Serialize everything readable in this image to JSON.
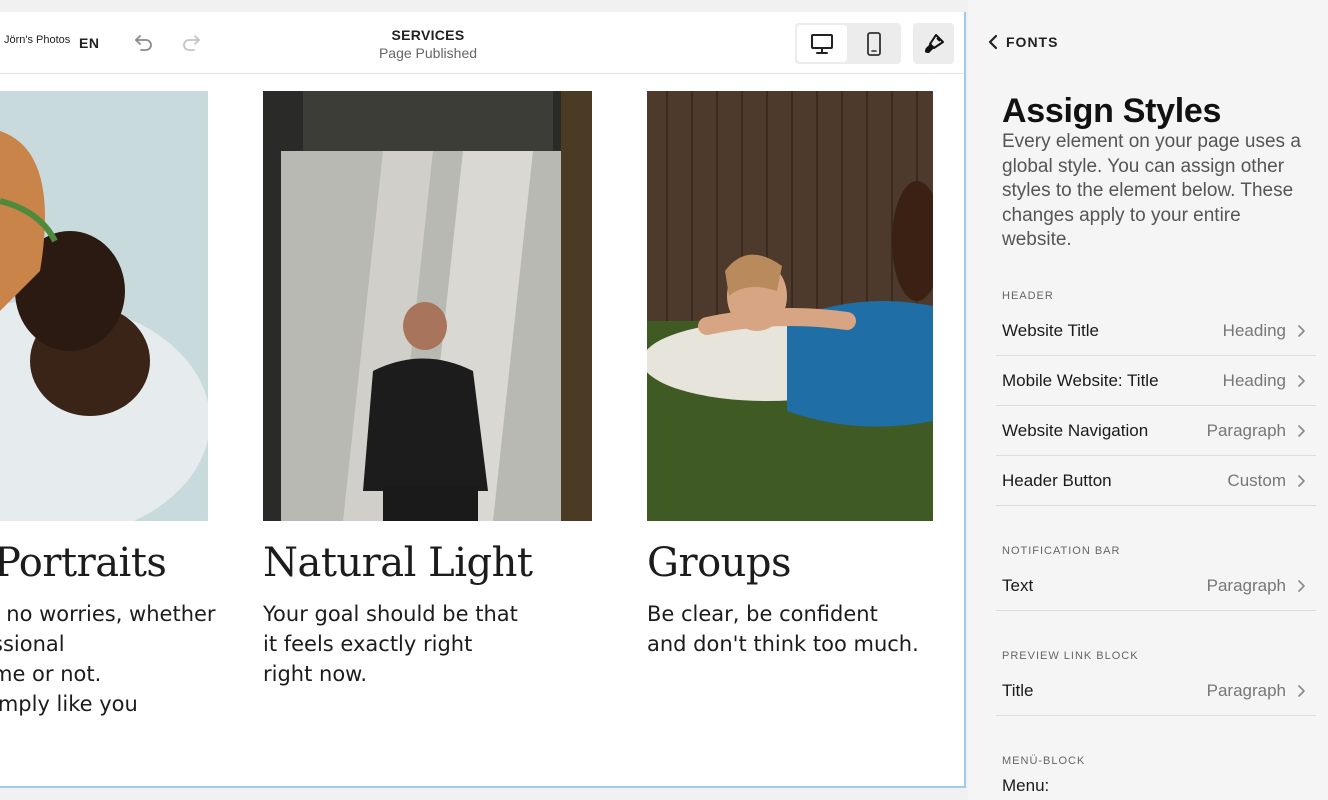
{
  "topbar": {
    "site_name": "Jörn's Photos",
    "language": "EN",
    "page_title": "SERVICES",
    "page_status": "Page Published"
  },
  "icons": {
    "undo": "undo-icon",
    "redo": "redo-icon",
    "desktop": "desktop-icon",
    "mobile": "mobile-icon",
    "design": "paintbrush-icon",
    "back": "chevron-left-icon",
    "row": "chevron-right-icon"
  },
  "colors": {
    "canvas_border": "#9ecbe6",
    "panel_bg": "#f5f5f5"
  },
  "gallery": [
    {
      "title": "Portraits",
      "lines": [
        "- no worries, whether",
        "ssional",
        "me or not.",
        "imply like you"
      ]
    },
    {
      "title": "Natural Light",
      "lines": [
        "Your goal should be that",
        "it feels exactly right",
        "right now."
      ]
    },
    {
      "title": "Groups",
      "lines": [
        "Be clear, be confident",
        "and don't think too much."
      ]
    }
  ],
  "panel": {
    "back_label": "FONTS",
    "title": "Assign Styles",
    "description": "Every element on your page uses a global style. You can assign other styles to the element below. These changes apply to your entire website.",
    "sections": [
      {
        "label": "HEADER",
        "rows": [
          {
            "label": "Website Title",
            "value": "Heading"
          },
          {
            "label": "Mobile Website: Title",
            "value": "Heading"
          },
          {
            "label": "Website Navigation",
            "value": "Paragraph"
          },
          {
            "label": "Header Button",
            "value": "Custom"
          }
        ]
      },
      {
        "label": "NOTIFICATION BAR",
        "rows": [
          {
            "label": "Text",
            "value": "Paragraph"
          }
        ]
      },
      {
        "label": "PREVIEW LINK BLOCK",
        "rows": [
          {
            "label": "Title",
            "value": "Paragraph"
          }
        ]
      },
      {
        "label": "MENÜ-BLOCK",
        "rows": [
          {
            "label": "Menu:",
            "value": ""
          }
        ]
      }
    ]
  }
}
